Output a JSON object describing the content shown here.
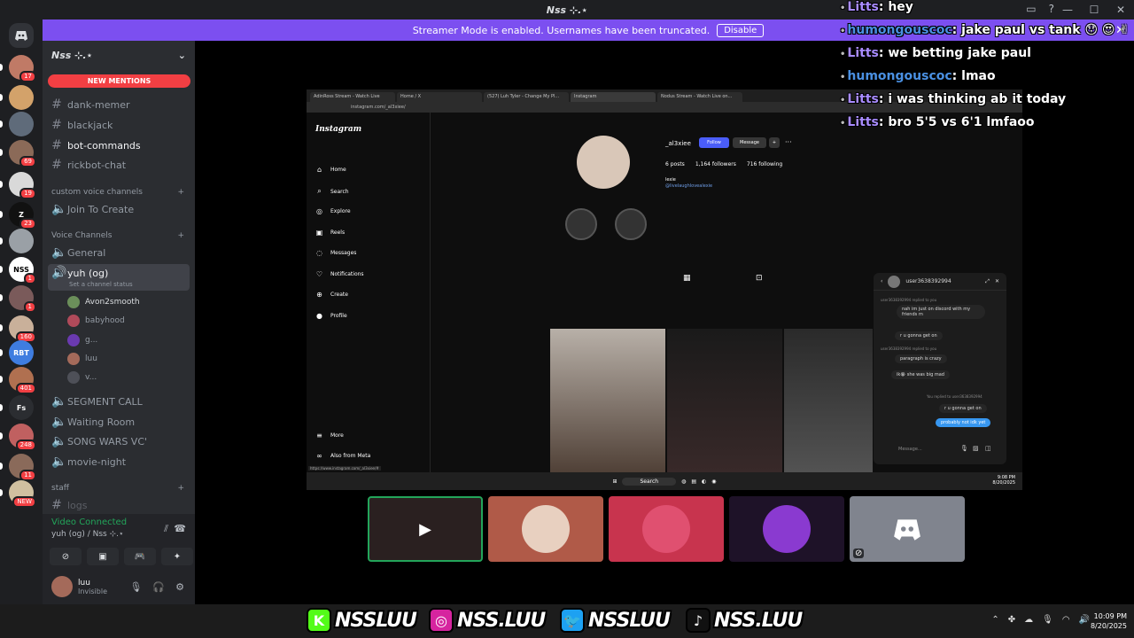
{
  "window": {
    "title": "Nss ⊹.⋆"
  },
  "banner": {
    "text": "Streamer Mode is enabled. Usernames have been truncated.",
    "button": "Disable"
  },
  "servers": [
    {
      "badge": "17",
      "color": "#c07a66"
    },
    {
      "badge": "",
      "color": "#d3a26a"
    },
    {
      "badge": "",
      "color": "#5f6b7a"
    },
    {
      "badge": "69",
      "color": "#8b6a58"
    },
    {
      "badge": "19",
      "color": "#d9d9d9"
    },
    {
      "badge": "23",
      "color": "#111111",
      "label": "Z"
    },
    {
      "badge": "",
      "color": "#9aa0a6"
    },
    {
      "badge": "1",
      "color": "#ffffff",
      "label": "NSS"
    },
    {
      "badge": "1",
      "color": "#7a5a5a"
    },
    {
      "badge": "160",
      "color": "#c9b09a"
    },
    {
      "badge": "",
      "color": "#3f7de0",
      "label": "RBT"
    },
    {
      "badge": "401",
      "color": "#b07050"
    },
    {
      "badge": "",
      "color": "#2b2d31",
      "label": "Fs"
    },
    {
      "badge": "248",
      "color": "#c06060"
    },
    {
      "badge": "11",
      "color": "#8a6a5a"
    },
    {
      "badge": "NEW",
      "color": "#d0c0a0"
    }
  ],
  "sidebar": {
    "server_name": "Nss ⊹.⋆",
    "new_mentions": "NEW MENTIONS",
    "channels": [
      "dank-memer",
      "blackjack",
      "bot-commands",
      "rickbot-chat"
    ],
    "cat_custom": "custom voice channels",
    "join_create": "Join To Create",
    "cat_voice": "Voice Channels",
    "general": "General",
    "yuh": "yuh (og)",
    "set_status": "Set a channel status",
    "voice_users": [
      "Avon2smooth",
      "babyhood",
      "g...",
      "luu",
      "v..."
    ],
    "segment": "SEGMENT CALL",
    "waiting": "Waiting Room",
    "songwars": "SONG WARS VC'",
    "movie": "movie-night",
    "cat_staff": "staff",
    "logs": "logs"
  },
  "voice_panel": {
    "status": "Video Connected",
    "channel": "yuh (og) / Nss ⊹.⋆",
    "user_name": "luu",
    "user_status": "Invisible"
  },
  "browser": {
    "tabs": [
      "AdinRoss Stream - Watch Live",
      "Home / X",
      "(527) Luh Tyler - Change My Pl...",
      "Instagram",
      "Nodus Stream - Watch Live on..."
    ],
    "address": "instagram.com/_al3xiee/"
  },
  "instagram": {
    "logo": "Instagram",
    "nav": [
      "Home",
      "Search",
      "Explore",
      "Reels",
      "Messages",
      "Notifications",
      "Create",
      "Profile"
    ],
    "more": "More",
    "meta": "Also from Meta",
    "username": "_al3xiee",
    "follow": "Follow",
    "message": "Message",
    "posts": "6 posts",
    "followers": "1,164 followers",
    "following": "716 following",
    "bio": "lexie",
    "link": "@livelaughlovealexie",
    "status_url": "https://www.instagram.com/_al3xiee/#"
  },
  "dm": {
    "user": "user3638392994",
    "lines": [
      "user3638392994 replied to you",
      "nah im just on discord with my friends rn",
      "r u gonna get on",
      "user3638392994 replied to you",
      "paragraph is crazy",
      "ik😭 she was big mad",
      "You replied to user3638392994",
      "r u gonna get on",
      "probably not idk yet"
    ],
    "placeholder": "Message..."
  },
  "stream_taskbar": {
    "search": "Search",
    "time": "9:08 PM",
    "date": "8/20/2025"
  },
  "chat": [
    {
      "user": "Litts",
      "msg": "hey",
      "color": "u1"
    },
    {
      "user": "humongouscoc",
      "msg": "jake paul vs tank 😯 😍 ✌",
      "color": "u2"
    },
    {
      "user": "Litts",
      "msg": "we betting jake paul",
      "color": "u1"
    },
    {
      "user": "humongouscoc",
      "msg": "lmao",
      "color": "u2"
    },
    {
      "user": "Litts",
      "msg": "i was thinking ab it today",
      "color": "u1"
    },
    {
      "user": "Litts",
      "msg": "bro 5'5 vs 6'1 lmfaoo",
      "color": "u1"
    }
  ],
  "socials": [
    {
      "icon": "K",
      "handle": "NSSLUU",
      "color": "#53fc18"
    },
    {
      "icon": "◎",
      "handle": "NSS.LUU",
      "color": "#d6249f"
    },
    {
      "icon": "🐦",
      "handle": "NSSLUU",
      "color": "#1da1f2"
    },
    {
      "icon": "♪",
      "handle": "NSS.LUU",
      "color": "#111111"
    }
  ],
  "system_clock": {
    "time": "10:09 PM",
    "date": "8/20/2025"
  }
}
